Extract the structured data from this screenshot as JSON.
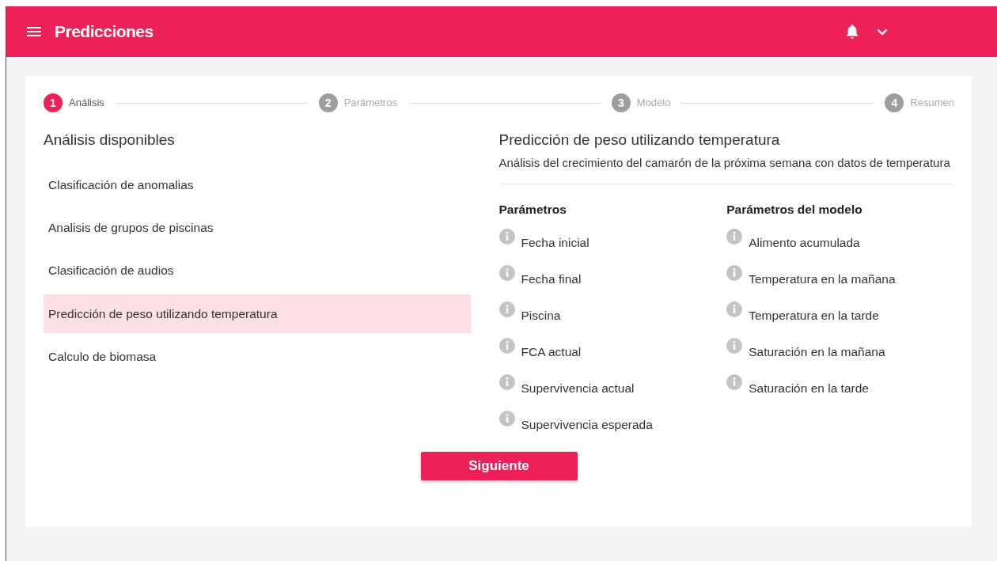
{
  "header": {
    "title": "Predicciones"
  },
  "steps": [
    {
      "number": "1",
      "label": "Análisis",
      "selected": true
    },
    {
      "number": "2",
      "label": "Parámetros",
      "selected": false
    },
    {
      "number": "3",
      "label": "Modelo",
      "selected": false
    },
    {
      "number": "4",
      "label": "Resumen",
      "selected": false
    }
  ],
  "analyses": {
    "title": "Análisis disponibles",
    "items": [
      {
        "label": "Clasificación de anomalias",
        "selected": false
      },
      {
        "label": "Analisis de grupos de piscinas",
        "selected": false
      },
      {
        "label": "Clasificación de audios",
        "selected": false
      },
      {
        "label": "Predicción de peso utilizando temperatura",
        "selected": true
      },
      {
        "label": "Calculo de biomasa",
        "selected": false
      }
    ]
  },
  "detail": {
    "title": "Predicción de peso utilizando temperatura",
    "description": "Análisis del crecimiento del camarón de la próxima semana con datos de temperatura",
    "parameter_groups": [
      {
        "title": "Parámetros",
        "items": [
          "Fecha inicial",
          "Fecha final",
          "Piscina",
          "FCA actual",
          "Supervivencia actual",
          "Supervivencia esperada"
        ]
      },
      {
        "title": "Parámetros del modelo",
        "items": [
          "Alimento acumulada",
          "Temperatura en la mañana",
          "Temperatura en la tarde",
          "Saturación en la mañana",
          "Saturación en la tarde"
        ]
      }
    ]
  },
  "next_button": "Siguiente"
}
